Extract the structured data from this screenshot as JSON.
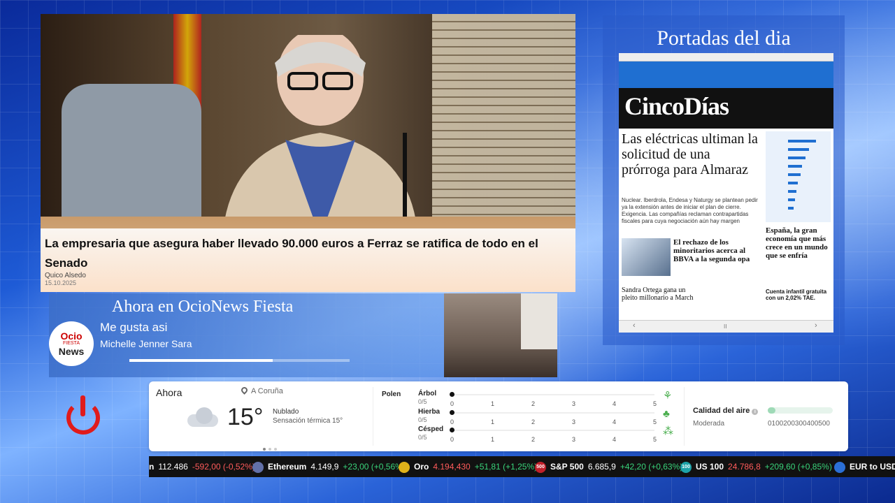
{
  "news": {
    "headline": "La empresaria que asegura haber llevado 90.000 euros a Ferraz se ratifica de todo en el Senado",
    "author": "Quico Alsedo",
    "date": "15.10.2025"
  },
  "portadas": {
    "title": "Portadas del dia",
    "newspaper": {
      "masthead": "CincoDías",
      "headline": "Las eléctricas ultiman la solicitud de una prórroga para Almaraz",
      "lede": "Nuclear. Iberdrola, Endesa y Naturgy se plantean pedir ya la extensión antes de iniciar el plan de cierre. Exigencia. Las compañías reclaman contrapartidas fiscales para cuya negociación aún hay margen",
      "side_headline": "España, la gran economía que más crece en un mundo que se enfría",
      "sub_headline": "El rechazo de los minoritarios acerca al BBVA a la segunda opa",
      "bottom_headline": "Sandra Ortega gana un pleito millonario a March",
      "promo": "Cuenta infantil gratuita con un 2,02% TAE.",
      "nav_prev": "‹",
      "nav_page": "II",
      "nav_next": "›"
    }
  },
  "music": {
    "channel": "Ahora en OcioNews Fiesta",
    "song": "Me gusta asi",
    "artist": "Michelle Jenner Sara",
    "progress": 0.65,
    "logo": {
      "line1": "Ocio",
      "line2": "FIESTA",
      "line3": "News"
    }
  },
  "weather": {
    "now_label": "Ahora",
    "location": "A Coruña",
    "temperature": "15°",
    "condition": "Nublado",
    "feels_like": "Sensación térmica 15°",
    "pollen": {
      "title": "Polen",
      "ticks": [
        "0",
        "1",
        "2",
        "3",
        "4",
        "5"
      ],
      "rows": [
        {
          "name": "Árbol",
          "score": "0/5",
          "icon": "tree-icon",
          "glyph": "⚘"
        },
        {
          "name": "Hierba",
          "score": "0/5",
          "icon": "grass-icon",
          "glyph": "♣"
        },
        {
          "name": "Césped",
          "score": "0/5",
          "icon": "lawn-icon",
          "glyph": "⁂"
        }
      ]
    },
    "air": {
      "title": "Calidad del aire",
      "level": "Moderada",
      "value_fraction": 0.12,
      "ticks": "0100200300400500"
    }
  },
  "ticker": [
    {
      "name": "n",
      "price": "112.486",
      "change": "-592,00 (-0,52%)",
      "direction": "down",
      "icon": "",
      "color": ""
    },
    {
      "name": "Ethereum",
      "price": "4.149,9",
      "change": "+23,00 (+0,56%)",
      "direction": "up",
      "icon": "ethereum-icon",
      "color": "#6270a8"
    },
    {
      "name": "Oro",
      "price": "4.194,430",
      "change": "+51,81 (+1,25%)",
      "direction": "up",
      "price_red": true,
      "icon": "gold-icon",
      "color": "#e0b21a"
    },
    {
      "name": "S&P 500",
      "price": "6.685,9",
      "change": "+42,20 (+0,63%)",
      "direction": "up",
      "icon": "sp500-icon",
      "color": "#c0202a",
      "badge": "500"
    },
    {
      "name": "US 100",
      "price": "24.786,8",
      "change": "+209,60 (+0,85%)",
      "direction": "up",
      "price_red": true,
      "icon": "us100-icon",
      "color": "#1da2a8",
      "badge": "100"
    },
    {
      "name": "EUR to USD",
      "price": "",
      "change": "",
      "direction": "up",
      "icon": "currency-icon",
      "color": "#2b6fd6"
    }
  ]
}
